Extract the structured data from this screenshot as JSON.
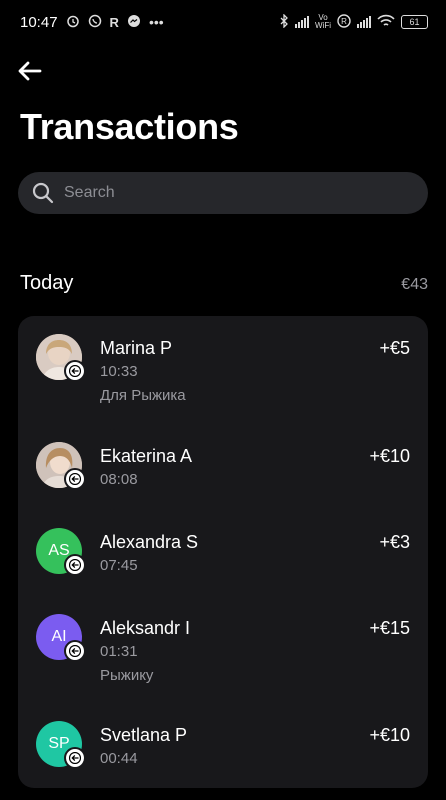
{
  "status_bar": {
    "time": "10:47",
    "left_icons": [
      "alarm-icon",
      "viber-icon",
      "r-app-icon",
      "messenger-icon",
      "more-dots-icon"
    ],
    "right_icons": [
      "bluetooth-icon",
      "signal-icon",
      "vowifi-icon",
      "registered-icon",
      "signal-icon",
      "wifi-icon",
      "battery-icon"
    ],
    "volte_label_top": "Vo",
    "volte_label_bottom": "WiFi",
    "battery": "61"
  },
  "header": {
    "back_icon": "arrow-left-icon",
    "title": "Transactions"
  },
  "search": {
    "placeholder": "Search",
    "value": ""
  },
  "section": {
    "title": "Today",
    "total": "€43"
  },
  "transactions": [
    {
      "name": "Marina P",
      "amount": "+€5",
      "time": "10:33",
      "note": "Для Рыжика",
      "initials": "",
      "avatar_color": "#c9b8ae",
      "avatar_type": "photo"
    },
    {
      "name": "Ekaterina A",
      "amount": "+€10",
      "time": "08:08",
      "note": "",
      "initials": "",
      "avatar_color": "#b7a79f",
      "avatar_type": "photo"
    },
    {
      "name": "Alexandra S",
      "amount": "+€3",
      "time": "07:45",
      "note": "",
      "initials": "AS",
      "avatar_color": "#35c15c",
      "avatar_type": "initials"
    },
    {
      "name": "Aleksandr I",
      "amount": "+€15",
      "time": "01:31",
      "note": "Рыжику",
      "initials": "AI",
      "avatar_color": "#7b5cf0",
      "avatar_type": "initials"
    },
    {
      "name": "Svetlana P",
      "amount": "+€10",
      "time": "00:44",
      "note": "",
      "initials": "SP",
      "avatar_color": "#1fc7a3",
      "avatar_type": "initials"
    }
  ],
  "colors": {
    "background": "#000000",
    "card": "#18181b",
    "search_bg": "#26272b",
    "secondary_text": "#9a9aa0"
  }
}
